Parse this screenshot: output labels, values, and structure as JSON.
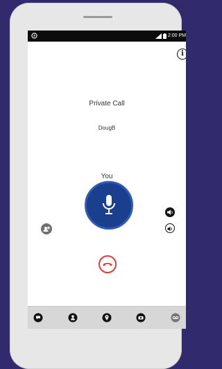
{
  "status_bar": {
    "time": "2:00 PM"
  },
  "call": {
    "type_label": "Private Call",
    "contact_name": "DougB",
    "current_speaker": "You"
  },
  "info_icon_glyph": "i",
  "icons": [
    "settings-icon",
    "signal-icon",
    "battery-icon",
    "info-icon",
    "microphone-icon",
    "add-participant-icon",
    "volume-icon",
    "audio-route-icon",
    "end-call-icon",
    "chat-icon",
    "contacts-icon",
    "location-icon",
    "video-icon",
    "voicemail-icon"
  ],
  "colors": {
    "ptt_fill": "#1a3f8e",
    "ptt_ring": "#2f5bb5",
    "end_call": "#e53935",
    "background": "#312a6c"
  }
}
